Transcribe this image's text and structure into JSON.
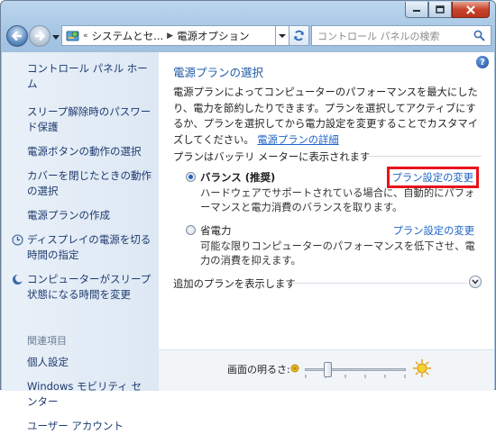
{
  "address": {
    "breadcrumb": [
      "システムとセ...",
      "電源オプション"
    ],
    "overflow": "«"
  },
  "search": {
    "placeholder": "コントロール パネルの検索"
  },
  "sidebar": {
    "home": "コントロール パネル ホーム",
    "items": [
      "スリープ解除時のパスワード保護",
      "電源ボタンの動作の選択",
      "カバーを閉じたときの動作の選択",
      "電源プランの作成",
      "ディスプレイの電源を切る時間の指定",
      "コンピューターがスリープ状態になる時間を変更"
    ],
    "see_also": "関連項目",
    "see_also_items": [
      "個人設定",
      "Windows モビリティ センター",
      "ユーザー アカウント"
    ]
  },
  "main": {
    "title": "電源プランの選択",
    "description": "電源プランによってコンピューターのパフォーマンスを最大にしたり、電力を節約したりできます。プランを選択してアクティブにするか、プランを選択してから電力設定を変更することでカスタマイズしてください。",
    "details_link": "電源プランの詳細",
    "group_label": "プランはバッテリ メーターに表示されます",
    "plans": [
      {
        "name": "バランス (推奨)",
        "selected": true,
        "change_link": "プラン設定の変更",
        "description": "ハードウェアでサポートされている場合に、自動的にパフォーマンスと電力消費のバランスを取ります。"
      },
      {
        "name": "省電力",
        "selected": false,
        "change_link": "プラン設定の変更",
        "description": "可能な限りコンピューターのパフォーマンスを低下させ、電力の消費を抑えます。"
      }
    ],
    "more_plans": "追加のプランを表示します",
    "brightness_label": "画面の明るさ:",
    "brightness_level": 0.2
  },
  "colors": {
    "link": "#1e64c8",
    "highlight_box": "#e8141c",
    "sidebar_link": "#1e3a6e"
  }
}
